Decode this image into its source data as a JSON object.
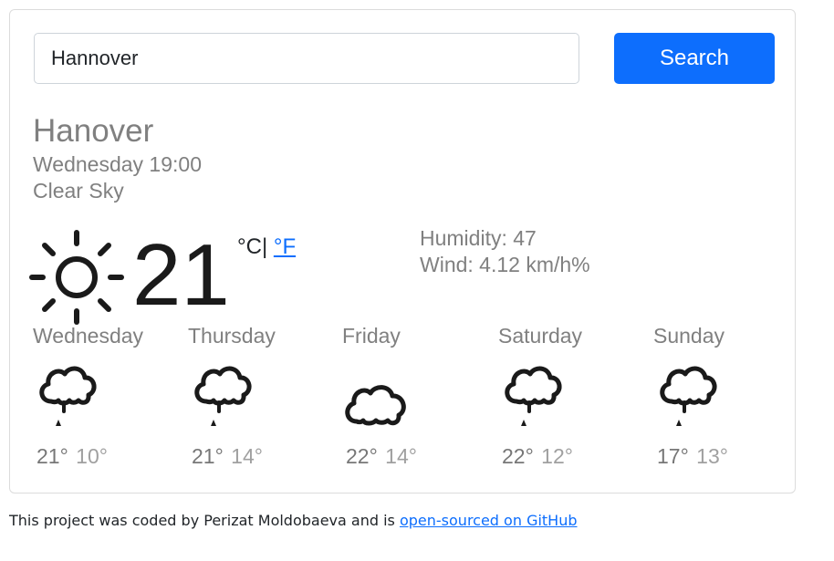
{
  "search": {
    "value": "Hannover",
    "button_label": "Search"
  },
  "current": {
    "city": "Hanover",
    "datetime": "Wednesday 19:00",
    "description": "Clear Sky",
    "icon": "sun-icon",
    "temperature": "21",
    "unit_celsius": "°C",
    "unit_separator": "|",
    "unit_fahrenheit": "°F",
    "humidity": "Humidity: 47",
    "wind": "Wind: 4.12 km/h%"
  },
  "forecast": [
    {
      "day": "Wednesday",
      "icon": "cloud-rain-icon",
      "max": "21°",
      "min": "10°"
    },
    {
      "day": "Thursday",
      "icon": "cloud-rain-icon",
      "max": "21°",
      "min": "14°"
    },
    {
      "day": "Friday",
      "icon": "cloud-icon",
      "max": "22°",
      "min": "14°"
    },
    {
      "day": "Saturday",
      "icon": "cloud-rain-icon",
      "max": "22°",
      "min": "12°"
    },
    {
      "day": "Sunday",
      "icon": "cloud-rain-icon",
      "max": "17°",
      "min": "13°"
    }
  ],
  "footer": {
    "text": "This project was coded by Perizat Moldobaeva and is ",
    "link_text": "open-sourced on GitHub"
  },
  "colors": {
    "accent": "#0d6efd",
    "muted_text": "#808080"
  }
}
